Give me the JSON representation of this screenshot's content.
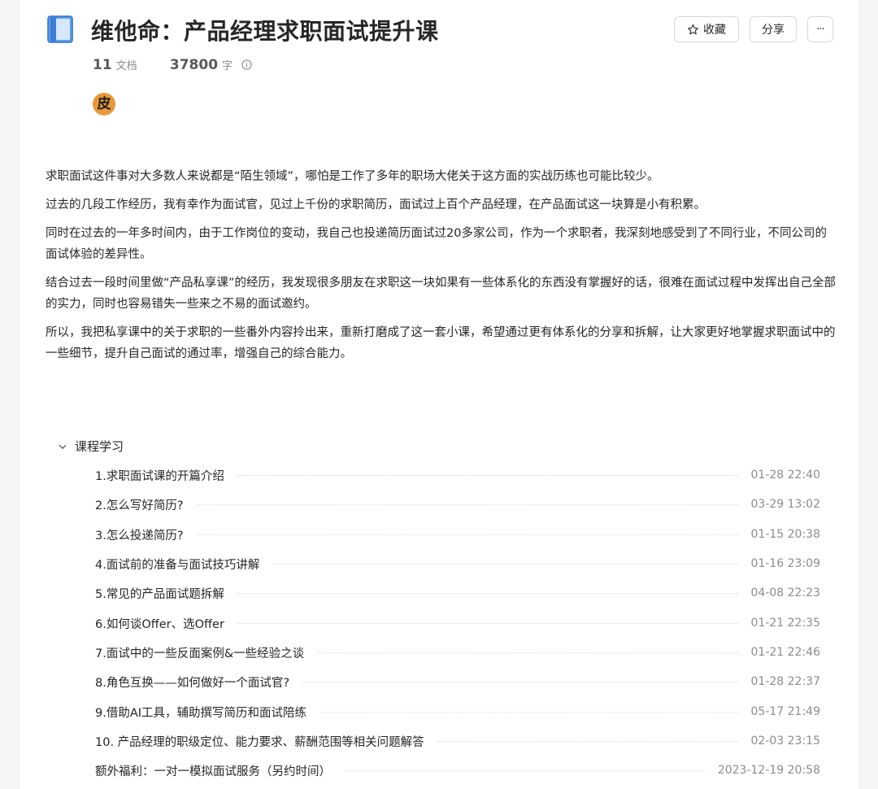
{
  "header": {
    "title": "维他命：产品经理求职面试提升课",
    "favorite_label": "收藏",
    "share_label": "分享",
    "more_label": "···",
    "doc_count": "11",
    "doc_unit": "文档",
    "word_count": "37800",
    "word_unit": "字",
    "avatar_text": "皮"
  },
  "description": [
    "求职面试这件事对大多数人来说都是“陌生领域”，哪怕是工作了多年的职场大佬关于这方面的实战历练也可能比较少。",
    "过去的几段工作经历，我有幸作为面试官，见过上千份的求职简历，面试过上百个产品经理，在产品面试这一块算是小有积累。",
    "同时在过去的一年多时间内，由于工作岗位的变动，我自己也投递简历面试过20多家公司，作为一个求职者，我深刻地感受到了不同行业，不同公司的面试体验的差异性。",
    "结合过去一段时间里做“产品私享课”的经历，我发现很多朋友在求职这一块如果有一些体系化的东西没有掌握好的话，很难在面试过程中发挥出自己全部的实力，同时也容易错失一些来之不易的面试邀约。",
    "所以，我把私享课中的关于求职的一些番外内容拎出来，重新打磨成了这一套小课，希望通过更有体系化的分享和拆解，让大家更好地掌握求职面试中的一些细节，提升自己面试的通过率，增强自己的综合能力。"
  ],
  "toc": {
    "section_title": "课程学习",
    "items": [
      {
        "title": "1.求职面试课的开篇介绍",
        "date": "01-28 22:40"
      },
      {
        "title": "2.怎么写好简历?",
        "date": "03-29 13:02"
      },
      {
        "title": "3.怎么投递简历?",
        "date": "01-15 20:38"
      },
      {
        "title": "4.面试前的准备与面试技巧讲解",
        "date": "01-16 23:09"
      },
      {
        "title": "5.常见的产品面试题拆解",
        "date": "04-08 22:23"
      },
      {
        "title": "6.如何谈Offer、选Offer",
        "date": "01-21 22:35"
      },
      {
        "title": "7.面试中的一些反面案例&一些经验之谈",
        "date": "01-21 22:46"
      },
      {
        "title": "8.角色互换——如何做好一个面试官?",
        "date": "01-28 22:37"
      },
      {
        "title": "9.借助AI工具，辅助撰写简历和面试陪练",
        "date": "05-17 21:49"
      },
      {
        "title": "10. 产品经理的职级定位、能力要求、薪酬范围等相关问题解答",
        "date": "02-03 23:15"
      }
    ],
    "extra": {
      "title": "额外福利：一对一模拟面试服务（另约时间）",
      "date": "2023-12-19 20:58"
    }
  },
  "colors": {
    "book_icon": "#4a90e2",
    "avatar_bg": "#e8973a"
  }
}
